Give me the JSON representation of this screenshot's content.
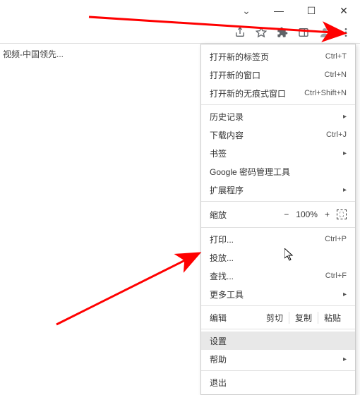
{
  "window": {
    "chevron": "⌄",
    "minimize": "—",
    "maximize": "☐",
    "close": "✕"
  },
  "toolbar": {
    "share_icon": "share",
    "star_icon": "star",
    "puzzle_icon": "extensions",
    "side_panel_icon": "side-panel",
    "profile_icon": "profile",
    "kebab_icon": "more"
  },
  "bookmark": {
    "text": "视频-中国领先..."
  },
  "menu": {
    "new_tab": {
      "label": "打开新的标签页",
      "shortcut": "Ctrl+T"
    },
    "new_window": {
      "label": "打开新的窗口",
      "shortcut": "Ctrl+N"
    },
    "incognito": {
      "label": "打开新的无痕式窗口",
      "shortcut": "Ctrl+Shift+N"
    },
    "history": {
      "label": "历史记录"
    },
    "downloads": {
      "label": "下载内容",
      "shortcut": "Ctrl+J"
    },
    "bookmarks": {
      "label": "书签"
    },
    "passwords": {
      "label": "Google 密码管理工具"
    },
    "extensions": {
      "label": "扩展程序"
    },
    "zoom": {
      "label": "缩放",
      "minus": "−",
      "percent": "100%",
      "plus": "+"
    },
    "print": {
      "label": "打印...",
      "shortcut": "Ctrl+P"
    },
    "cast": {
      "label": "投放..."
    },
    "find": {
      "label": "查找...",
      "shortcut": "Ctrl+F"
    },
    "more_tools": {
      "label": "更多工具"
    },
    "edit": {
      "label": "编辑",
      "cut": "剪切",
      "copy": "复制",
      "paste": "粘贴"
    },
    "settings": {
      "label": "设置"
    },
    "help": {
      "label": "帮助"
    },
    "exit": {
      "label": "退出"
    }
  },
  "annotations": {
    "arrow_color": "#ff0000"
  }
}
